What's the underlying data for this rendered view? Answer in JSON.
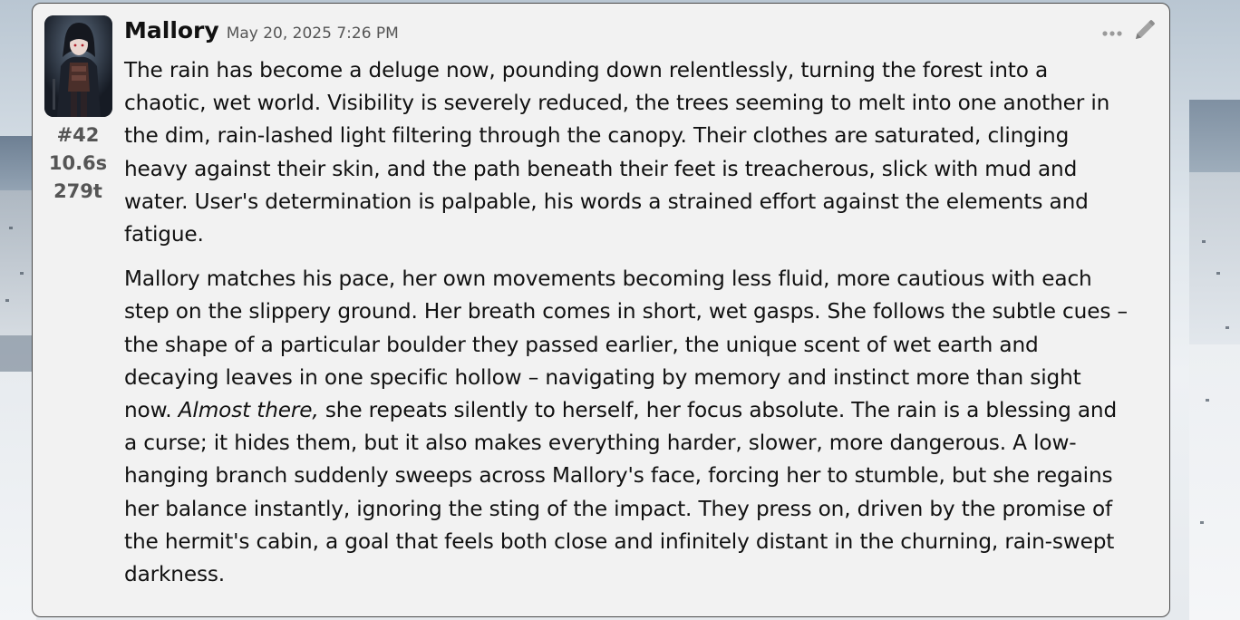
{
  "message": {
    "author": "Mallory",
    "timestamp": "May 20, 2025 7:26 PM",
    "index": "#42",
    "gen_time": "10.6s",
    "tokens": "279t",
    "paragraphs": [
      {
        "text": "The rain has become a deluge now, pounding down relentlessly, turning the forest into a chaotic, wet world. Visibility is severely reduced, the trees seeming to melt into one another in the dim, rain-lashed light filtering through the canopy. Their clothes are saturated, clinging heavy against their skin, and the path beneath their feet is treacherous, slick with mud and water. User's determination is palpable, his words a strained effort against the elements and fatigue."
      },
      {
        "before": "Mallory matches his pace, her own movements becoming less fluid, more cautious with each step on the slippery ground. Her breath comes in short, wet gasps. She follows the subtle cues – the shape of a particular boulder they passed earlier, the unique scent of wet earth and decaying leaves in one specific hollow – navigating by memory and instinct more than sight now. ",
        "italic": "Almost there,",
        "after": " she repeats silently to herself, her focus absolute. The rain is a blessing and a curse; it hides them, but it also makes everything harder, slower, more dangerous. A low-hanging branch suddenly sweeps across Mallory's face, forcing her to stumble, but she regains her balance instantly, ignoring the sting of the impact. They press on, driven by the promise of the hermit's cabin, a goal that feels both close and infinitely distant in the churning, rain-swept darkness."
      }
    ]
  },
  "icons": {
    "more": "more-options-icon",
    "edit": "pencil-edit-icon",
    "avatar": "character-avatar"
  },
  "colors": {
    "card_background": "#f2f2f2",
    "card_border": "#4b4b4b",
    "text": "#111111",
    "muted": "#555555",
    "icon": "#9a9a9a"
  }
}
